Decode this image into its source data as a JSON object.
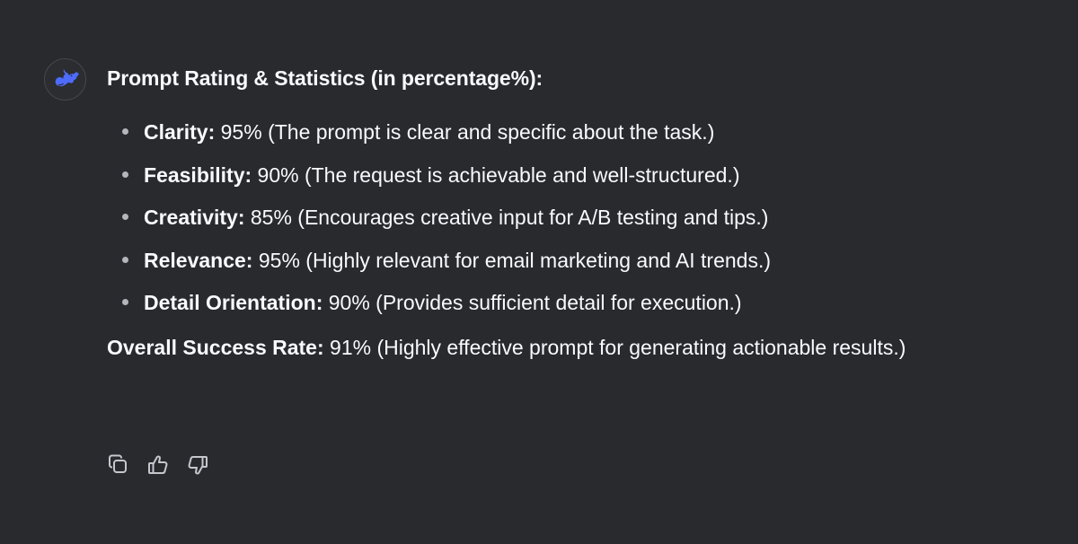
{
  "message": {
    "title": "Prompt Rating & Statistics (in percentage%):",
    "items": [
      {
        "key": "Clarity:",
        "value": " 95% (The prompt is clear and specific about the task.)"
      },
      {
        "key": "Feasibility:",
        "value": " 90% (The request is achievable and well-structured.)"
      },
      {
        "key": "Creativity:",
        "value": " 85% (Encourages creative input for A/B testing and tips.)"
      },
      {
        "key": "Relevance:",
        "value": " 95% (Highly relevant for email marketing and AI trends.)"
      },
      {
        "key": "Detail Orientation:",
        "value": " 90% (Provides sufficient detail for execution.)"
      }
    ],
    "summary": {
      "key": "Overall Success Rate:",
      "value": " 91% (Highly effective prompt for generating actionable results.)"
    }
  },
  "actions": {
    "icons": [
      "copy-icon",
      "thumbs-up-icon",
      "thumbs-down-icon"
    ]
  },
  "colors": {
    "background": "#292a2d",
    "text": "#f8faff",
    "accent": "#4d6bfe",
    "icon": "#c4c7ce"
  }
}
